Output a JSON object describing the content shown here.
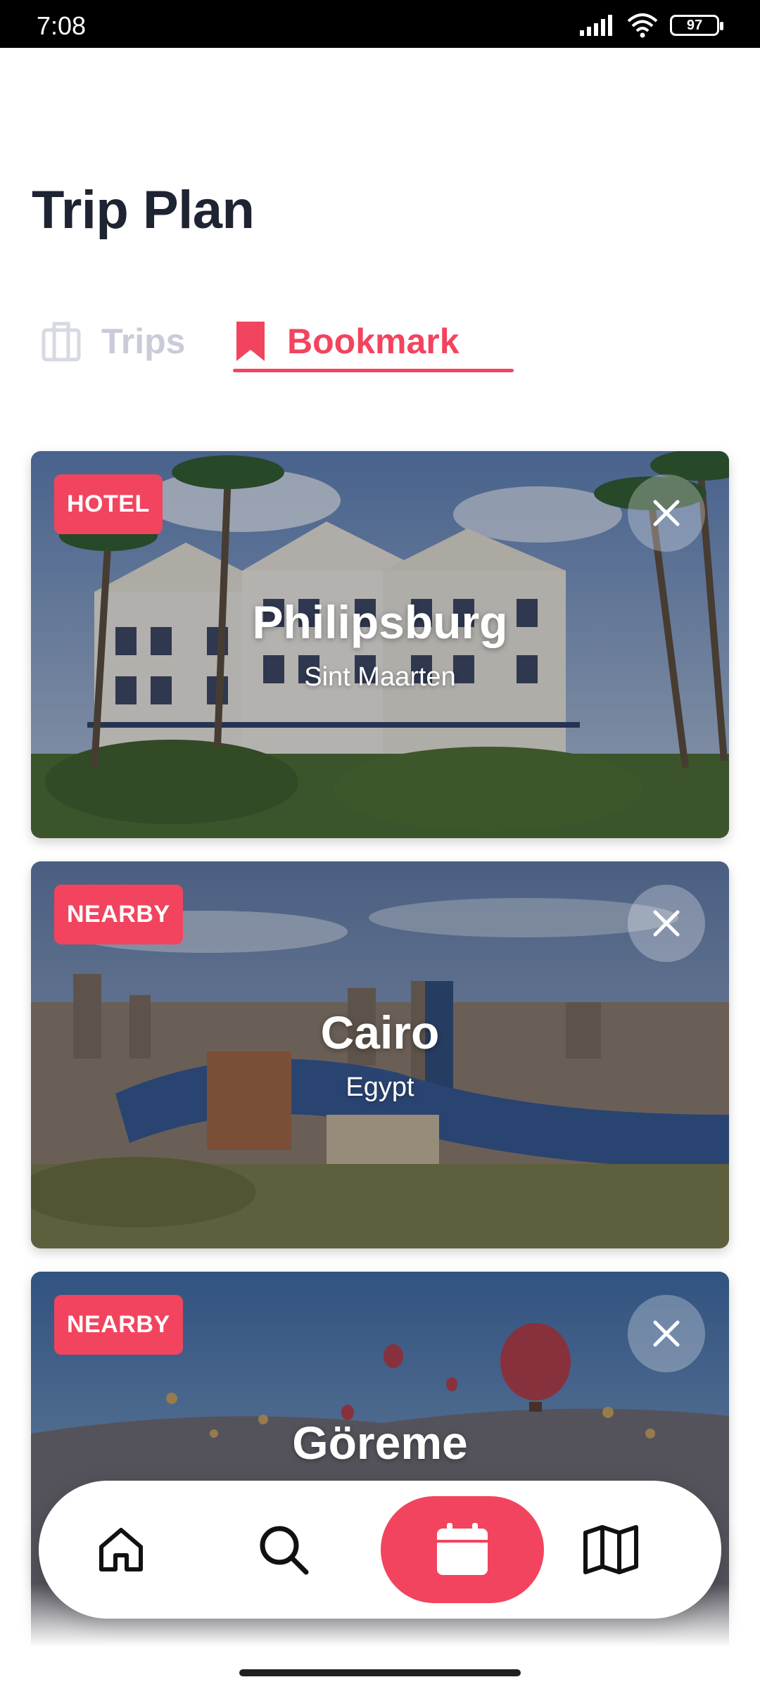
{
  "status_bar": {
    "time": "7:08",
    "battery": "97"
  },
  "header": {
    "title": "Trip Plan"
  },
  "tabs": [
    {
      "label": "Trips",
      "active": false
    },
    {
      "label": "Bookmark",
      "active": true
    }
  ],
  "cards": [
    {
      "badge": "HOTEL",
      "city": "Philipsburg",
      "country": "Sint Maarten"
    },
    {
      "badge": "NEARBY",
      "city": "Cairo",
      "country": "Egypt"
    },
    {
      "badge": "NEARBY",
      "city": "Göreme",
      "country": ""
    }
  ],
  "bottom_nav": {
    "items": [
      {
        "icon": "home-icon"
      },
      {
        "icon": "search-icon"
      },
      {
        "icon": "calendar-icon",
        "active": true
      },
      {
        "icon": "map-icon"
      }
    ]
  },
  "colors": {
    "accent": "#f2445e",
    "title": "#1f2433",
    "inactive_tab": "#c9cbd8"
  }
}
